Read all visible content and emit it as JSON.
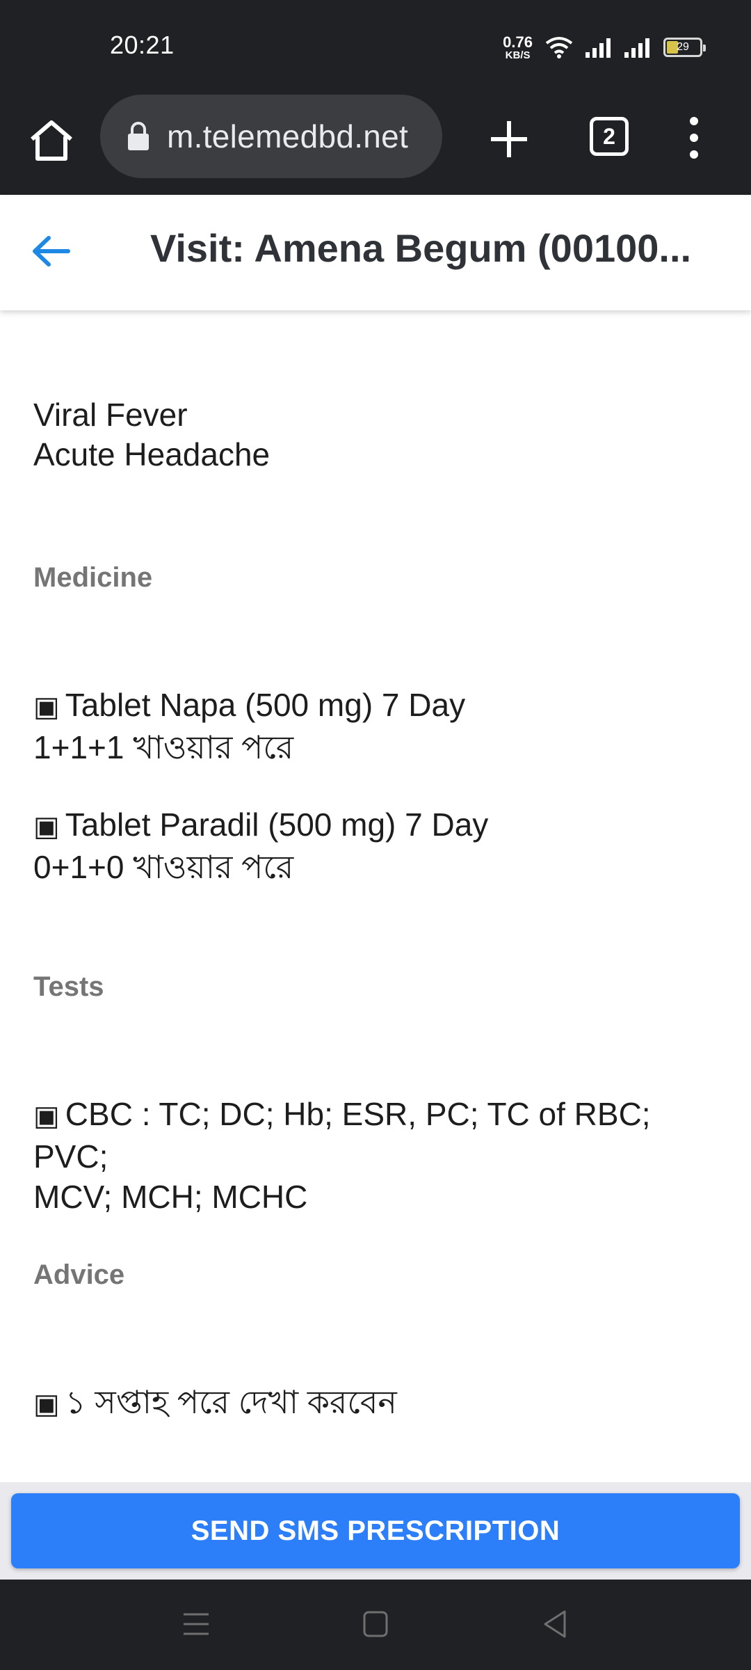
{
  "status_bar": {
    "time": "20:21",
    "net_speed_value": "0.76",
    "net_speed_unit": "KB/S",
    "battery_level": "29"
  },
  "browser": {
    "url": "m.telemedbd.net",
    "tab_count": "2"
  },
  "header": {
    "title": "Visit: Amena Begum (00100..."
  },
  "diagnosis": [
    "Viral Fever",
    "Acute Headache"
  ],
  "sections": {
    "medicine_label": "Medicine",
    "tests_label": "Tests",
    "advice_label": "Advice"
  },
  "medicines": [
    {
      "line1": "Tablet Napa (500 mg)  7  Day",
      "line2": "1+1+1  খাওয়ার পরে"
    },
    {
      "line1": "Tablet Paradil (500 mg)  7  Day",
      "line2": "0+1+0  খাওয়ার পরে"
    }
  ],
  "tests": [
    {
      "line1": "CBC : TC; DC; Hb; ESR, PC; TC of RBC; PVC;",
      "line2": "MCV; MCH; MCHC"
    }
  ],
  "advice": [
    {
      "text": "১ সপ্তাহ পরে দেখা করবেন"
    }
  ],
  "bullet_symbol": "▣",
  "actions": {
    "send_sms_label": "SEND SMS PRESCRIPTION"
  },
  "colors": {
    "accent": "#2d7ff9",
    "back_arrow": "#1e88e5",
    "section_label": "#757575",
    "browser_chrome": "#202124"
  },
  "icons": [
    "home-icon",
    "lock-icon",
    "plus-icon",
    "tabs-icon",
    "menu-icon",
    "back-arrow-icon",
    "wifi-icon",
    "signal-icon",
    "battery-icon",
    "nav-menu-icon",
    "nav-home-icon",
    "nav-back-icon"
  ]
}
